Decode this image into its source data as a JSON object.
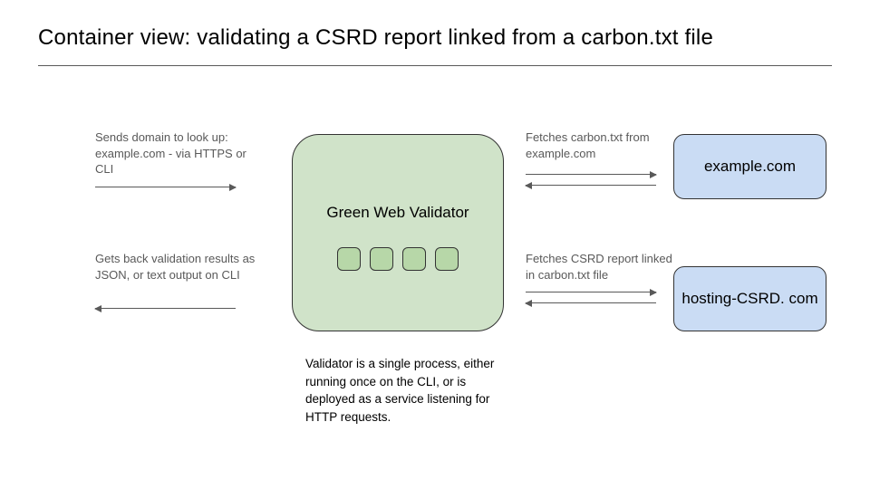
{
  "title": "Container view: validating a CSRD report linked from a carbon.txt file",
  "validator": {
    "label": "Green Web Validator",
    "caption": "Validator is a single process, either running once on the CLI, or is deployed as a service listening for HTTP requests."
  },
  "external": {
    "example": "example.com",
    "hosting": "hosting-CSRD. com"
  },
  "annotations": {
    "send": "Sends domain to look up: example.com - via HTTPS or CLI",
    "get": "Gets back validation results as JSON, or text output on CLI",
    "fetch_carbon": "Fetches carbon.txt from example.com",
    "fetch_csrd": "Fetches CSRD report linked in carbon.txt file"
  }
}
